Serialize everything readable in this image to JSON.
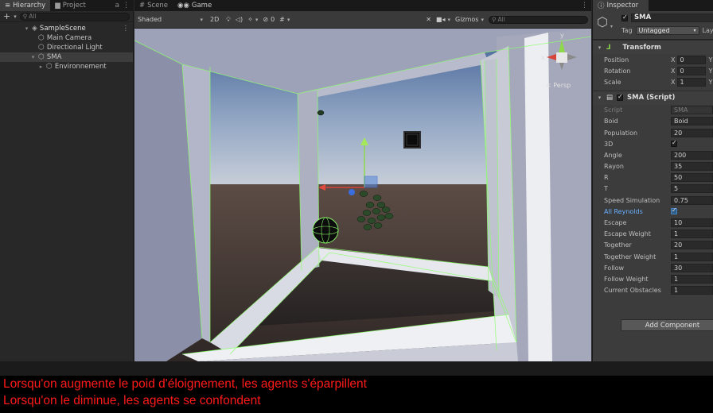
{
  "hierarchy": {
    "tabs": [
      {
        "label": "Hierarchy"
      },
      {
        "label": "Project"
      }
    ],
    "search_placeholder": "All",
    "items": [
      {
        "label": "SampleScene"
      },
      {
        "label": "Main Camera"
      },
      {
        "label": "Directional Light"
      },
      {
        "label": "SMA"
      },
      {
        "label": "Environnement"
      }
    ]
  },
  "scene": {
    "tabs": [
      {
        "label": "Scene"
      },
      {
        "label": "Game"
      }
    ],
    "shading": "Shaded",
    "mode_2d": "2D",
    "hidden_count": "0",
    "gizmos": "Gizmos",
    "search_placeholder": "All",
    "persp_label": "< Persp",
    "gizmo_axes": {
      "y": "y",
      "x": "x"
    }
  },
  "inspector": {
    "tab": "Inspector",
    "object_name": "SMA",
    "tag_label": "Tag",
    "tag_value": "Untagged",
    "layer_label": "Layer",
    "transform": {
      "title": "Transform",
      "rows": [
        {
          "label": "Position",
          "x": "0",
          "y": "Y"
        },
        {
          "label": "Rotation",
          "x": "0",
          "y": "Y"
        },
        {
          "label": "Scale",
          "x": "1",
          "y": "Y"
        }
      ]
    },
    "script_component": {
      "title": "SMA (Script)",
      "rows": [
        {
          "label": "Script",
          "value": "SMA"
        },
        {
          "label": "Boid",
          "value": "Boid"
        },
        {
          "label": "Population",
          "value": "20"
        },
        {
          "label": "3D",
          "value": "✓"
        },
        {
          "label": "Angle",
          "value": "200"
        },
        {
          "label": "Rayon",
          "value": "35"
        },
        {
          "label": "R",
          "value": "50"
        },
        {
          "label": "T",
          "value": "5"
        },
        {
          "label": "Speed Simulation",
          "value": "0.75"
        },
        {
          "label": "All Reynolds",
          "value": ""
        },
        {
          "label": "Escape",
          "value": "10"
        },
        {
          "label": "Escape Weight",
          "value": "1"
        },
        {
          "label": "Together",
          "value": "20"
        },
        {
          "label": "Together Weight",
          "value": "1"
        },
        {
          "label": "Follow",
          "value": "30"
        },
        {
          "label": "Follow Weight",
          "value": "1"
        },
        {
          "label": "Current Obstacles",
          "value": "1"
        }
      ]
    },
    "add_component": "Add Component"
  },
  "caption": {
    "line1": "Lorsqu'on augmente le poid d'éloignement, les agents s'éparpillent",
    "line2": "Lorsqu'on le diminue, les agents se confondent"
  }
}
